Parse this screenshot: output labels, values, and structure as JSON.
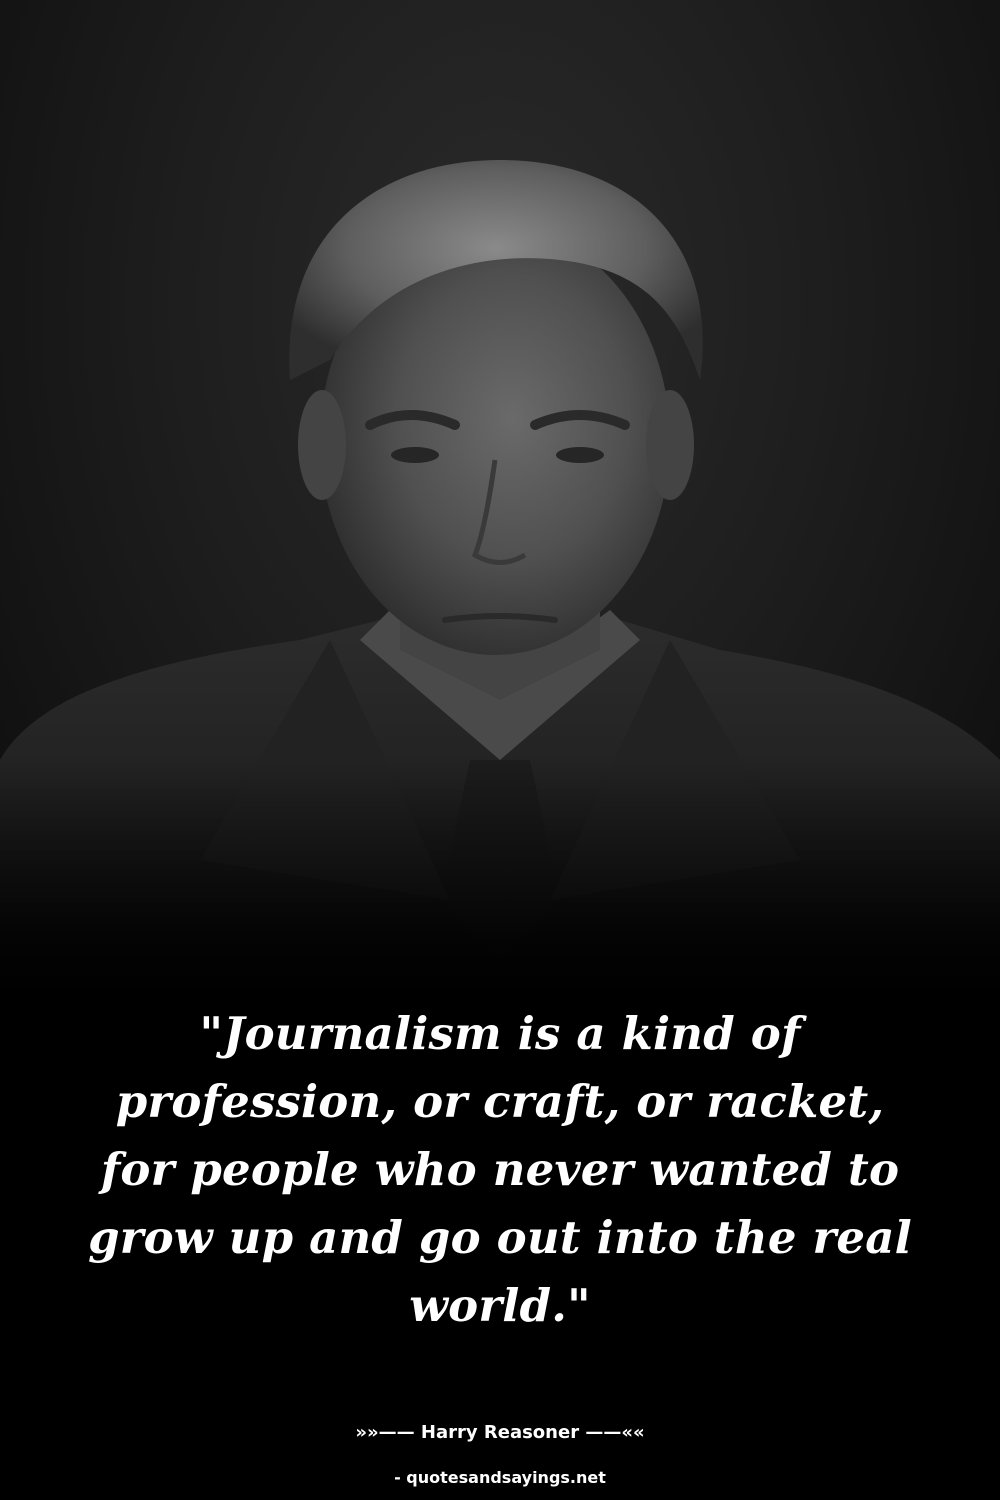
{
  "quote": {
    "text": "\"Journalism is a kind of profession, or craft, or racket, for people who never wanted to grow up and go out into the real world.\""
  },
  "author": {
    "line": "»»—— Harry Reasoner ——««"
  },
  "source": {
    "text": "- quotesandsayings.net"
  },
  "photo": {
    "subject": "portrait-photo",
    "tone": "black-and-white"
  },
  "colors": {
    "background": "#000000",
    "text": "#ffffff"
  }
}
